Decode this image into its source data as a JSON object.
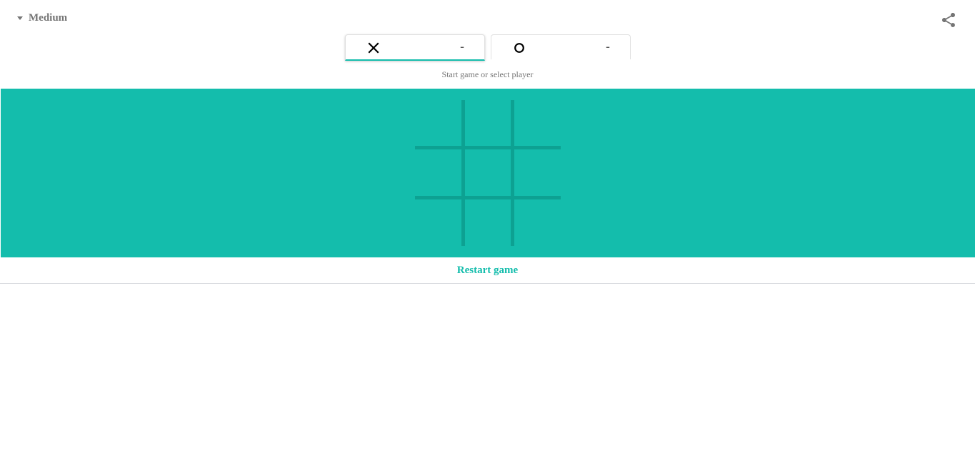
{
  "difficulty": {
    "label": "Medium"
  },
  "share": {
    "icon": "share-icon"
  },
  "players": [
    {
      "mark": "x-mark-icon",
      "score": "-",
      "active": true
    },
    {
      "mark": "o-mark-icon",
      "score": "-",
      "active": false
    }
  ],
  "status": "Start game or select player",
  "board": {
    "cells": [
      "",
      "",
      "",
      "",
      "",
      "",
      "",
      "",
      ""
    ]
  },
  "restart_label": "Restart game",
  "colors": {
    "accent": "#14bdac",
    "grid": "#0da192",
    "muted": "#757575"
  }
}
